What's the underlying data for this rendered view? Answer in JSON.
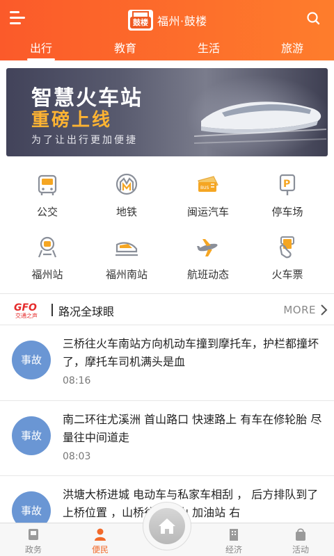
{
  "header": {
    "city": "福州·鼓楼",
    "logo_text": "鼓楼",
    "tabs": [
      {
        "label": "出行",
        "active": true
      },
      {
        "label": "教育",
        "active": false
      },
      {
        "label": "生活",
        "active": false
      },
      {
        "label": "旅游",
        "active": false
      }
    ]
  },
  "banner": {
    "line1": "智慧火车站",
    "line2": "重磅上线",
    "line3": "为了让出行更加便捷"
  },
  "services": [
    {
      "label": "公交",
      "icon": "bus-icon"
    },
    {
      "label": "地铁",
      "icon": "metro-icon"
    },
    {
      "label": "闽运汽车",
      "icon": "bus-ticket-icon"
    },
    {
      "label": "停车场",
      "icon": "parking-icon"
    },
    {
      "label": "福州站",
      "icon": "station-icon"
    },
    {
      "label": "福州南站",
      "icon": "high-speed-train-icon"
    },
    {
      "label": "航班动态",
      "icon": "airplane-icon"
    },
    {
      "label": "火车票",
      "icon": "train-ticket-icon"
    }
  ],
  "section": {
    "logo_text": "交通之声",
    "title": "路况全球眼",
    "more": "MORE"
  },
  "news": [
    {
      "tag": "事故",
      "text": "三桥往火车南站方向机动车撞到摩托车，护栏都撞坏了，摩托车司机满头是血",
      "time": "08:16"
    },
    {
      "tag": "事故",
      "text": "南二环往尤溪洲 首山路口 快速路上 有车在修轮胎 尽量往中间道走",
      "time": "08:03"
    },
    {
      "tag": "事故",
      "text": "洪塘大桥进城 电动车与私家车相刮 ， 后方排队到了上桥位置 ，山桥往妙峰山 加油站 右",
      "time": ""
    }
  ],
  "bottom_nav": [
    {
      "label": "政务",
      "icon": "government-icon",
      "active": false
    },
    {
      "label": "便民",
      "icon": "person-icon",
      "active": true
    },
    {
      "label": "经济",
      "icon": "building-icon",
      "active": false
    },
    {
      "label": "活动",
      "icon": "bag-icon",
      "active": false
    }
  ],
  "colors": {
    "brand": "#fb5a2a",
    "badge": "#6a96d4",
    "banner_highlight": "#ffb432",
    "icon_accent": "#f5a623"
  }
}
